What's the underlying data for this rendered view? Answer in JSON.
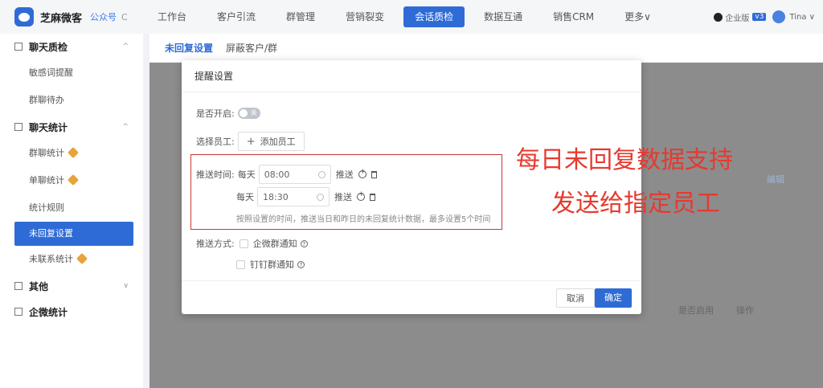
{
  "topbar": {
    "brand": "芝麻微客",
    "brand_sub": "公众号",
    "brand_sub2": "C",
    "nav": [
      "工作台",
      "客户引流",
      "群管理",
      "营销裂变",
      "会话质检",
      "数据互通",
      "销售CRM",
      "更多∨"
    ],
    "right": {
      "edition": "企业版",
      "version": "v3",
      "user": "Tina ∨"
    }
  },
  "sidebar": {
    "group1": {
      "label": "聊天质检",
      "arrow": "^"
    },
    "items1": [
      "敏感词提醒",
      "群聊待办"
    ],
    "group2": {
      "label": "聊天统计",
      "arrow": "^"
    },
    "items2": [
      "群聊统计",
      "单聊统计",
      "统计规则",
      "未回复设置",
      "未联系统计"
    ],
    "group3": {
      "label": "其他",
      "arrow": "∨"
    },
    "group4": {
      "label": "企微统计"
    }
  },
  "main": {
    "tabs": [
      "未回复设置",
      "屏蔽客户/群"
    ],
    "bg": {
      "edit": "编辑",
      "enabled_col": "是否启用",
      "action_col": "操作"
    }
  },
  "modal": {
    "title": "提醒设置",
    "enable_label": "是否开启:",
    "toggle_text": "关",
    "staff_label": "选择员工:",
    "add_staff": "添加员工",
    "push_time_label": "推送时间:",
    "times": [
      {
        "prefix": "每天",
        "value": "08:00",
        "suffix": "推送"
      },
      {
        "prefix": "每天",
        "value": "18:30",
        "suffix": "推送"
      }
    ],
    "hint": "按照设置的时间，推送当日和昨日的未回复统计数据，最多设置5个时间",
    "push_method_label": "推送方式:",
    "methods": [
      "企微群通知",
      "钉钉群通知"
    ],
    "cancel": "取消",
    "confirm": "确定"
  },
  "annotation": [
    "每日未回复数据支持",
    "发送给指定员工"
  ],
  "colors": {
    "accent": "#2f6bd6",
    "annotation": "#e53a2f"
  }
}
